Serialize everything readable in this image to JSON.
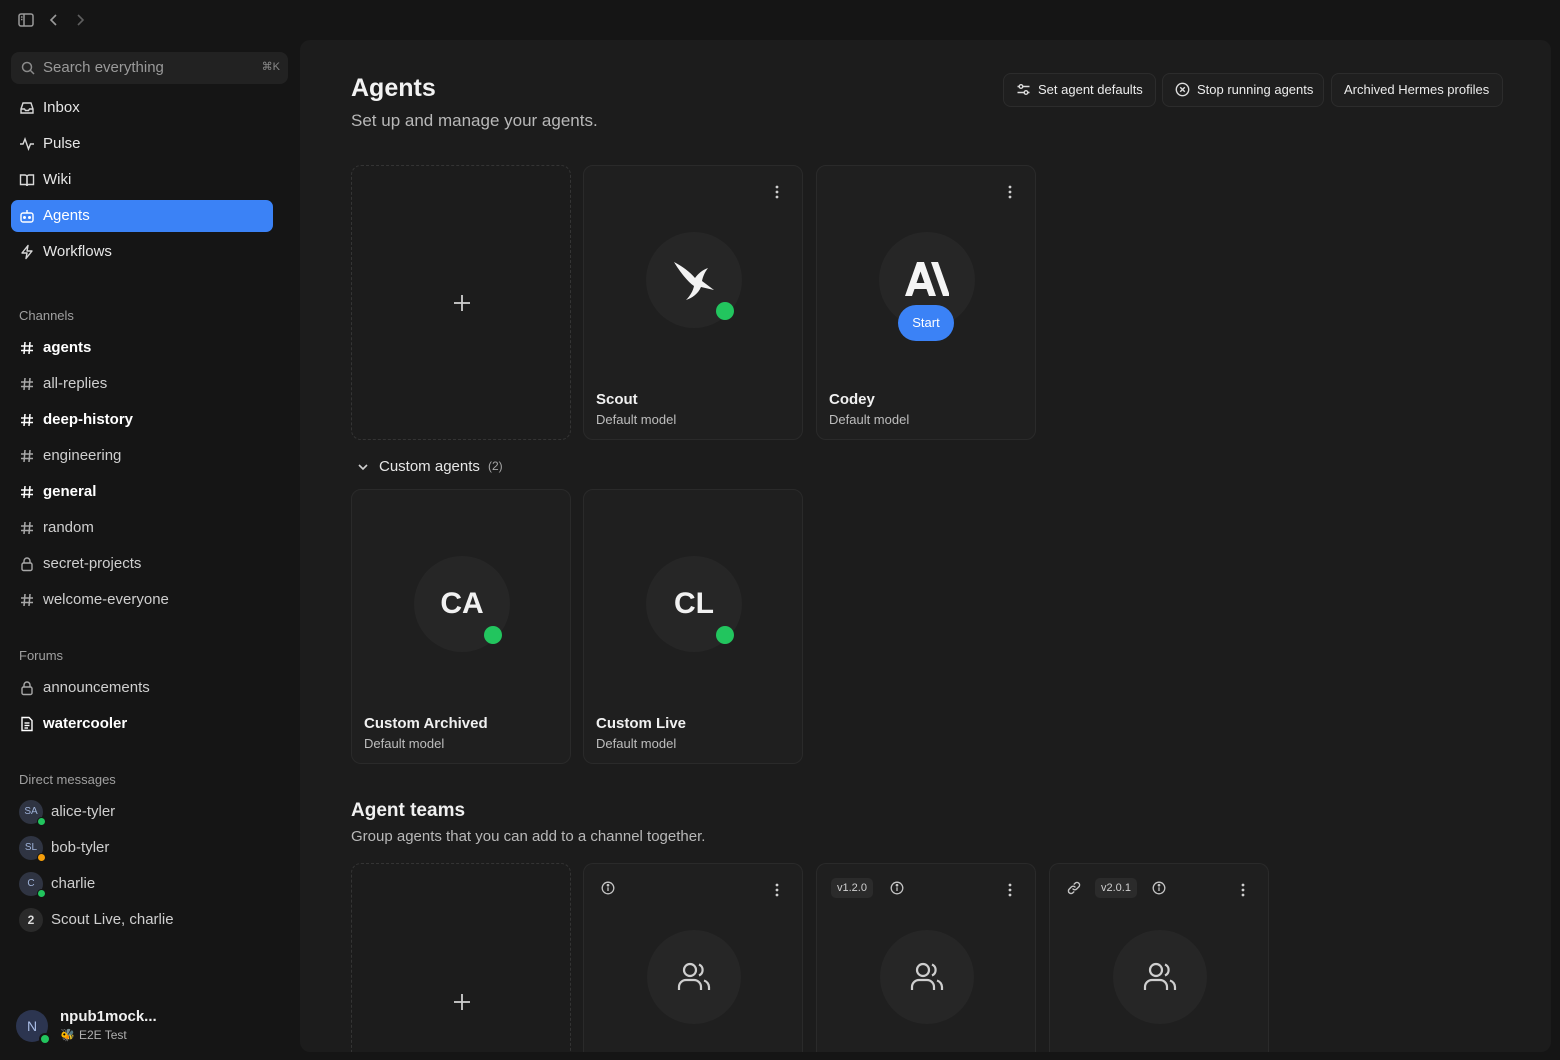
{
  "sidebar": {
    "search": {
      "placeholder": "Search everything",
      "shortcut": "⌘K"
    },
    "nav": [
      {
        "label": "Inbox",
        "icon": "inbox-icon"
      },
      {
        "label": "Pulse",
        "icon": "pulse-icon"
      },
      {
        "label": "Wiki",
        "icon": "book-icon"
      },
      {
        "label": "Agents",
        "icon": "bot-icon",
        "active": true
      },
      {
        "label": "Workflows",
        "icon": "lightning-icon"
      }
    ],
    "channels_title": "Channels",
    "channels": [
      {
        "name": "agents",
        "icon": "hash-icon",
        "unread": true
      },
      {
        "name": "all-replies",
        "icon": "hash-icon",
        "unread": false
      },
      {
        "name": "deep-history",
        "icon": "hash-icon",
        "unread": true
      },
      {
        "name": "engineering",
        "icon": "hash-icon",
        "unread": false
      },
      {
        "name": "general",
        "icon": "hash-icon",
        "unread": true
      },
      {
        "name": "random",
        "icon": "hash-icon",
        "unread": false
      },
      {
        "name": "secret-projects",
        "icon": "lock-icon",
        "unread": false
      },
      {
        "name": "welcome-everyone",
        "icon": "hash-icon",
        "unread": false
      }
    ],
    "forums_title": "Forums",
    "forums": [
      {
        "name": "announcements",
        "icon": "lock-icon",
        "unread": false
      },
      {
        "name": "watercooler",
        "icon": "document-icon",
        "unread": true
      }
    ],
    "dm_title": "Direct messages",
    "dms": [
      {
        "name": "alice-tyler",
        "avatar": "SA",
        "status": "online"
      },
      {
        "name": "bob-tyler",
        "avatar": "SL",
        "status": "away"
      },
      {
        "name": "charlie",
        "avatar": "C",
        "status": "online"
      },
      {
        "name": "Scout Live, charlie",
        "avatar": "2",
        "status": "none"
      }
    ],
    "user": {
      "initial": "N",
      "name": "npub1mock...",
      "subtitle": "E2E Test",
      "subtitle_icon": "bee-emoji"
    }
  },
  "main": {
    "title": "Agents",
    "subtitle": "Set up and manage your agents.",
    "header_buttons": [
      {
        "label": "Set agent defaults",
        "icon": "sliders-icon"
      },
      {
        "label": "Stop running agents",
        "icon": "stop-circle-icon"
      },
      {
        "label": "Archived Hermes profiles"
      }
    ],
    "agents": [
      {
        "name": "Scout",
        "model": "Default model",
        "avatar": "bird-icon",
        "status": "online"
      },
      {
        "name": "Codey",
        "model": "Default model",
        "avatar": "anthropic-logo",
        "action": "Start"
      }
    ],
    "custom_group": {
      "label": "Custom agents",
      "count": "(2)"
    },
    "custom_agents": [
      {
        "name": "Custom Archived",
        "model": "Default model",
        "initials": "CA",
        "status": "online"
      },
      {
        "name": "Custom Live",
        "model": "Default model",
        "initials": "CL",
        "status": "online"
      }
    ],
    "teams_title": "Agent teams",
    "teams_subtitle": "Group agents that you can add to a channel together.",
    "teams": [
      {
        "version": "",
        "linked": false
      },
      {
        "version": "v1.2.0",
        "linked": false
      },
      {
        "version": "v2.0.1",
        "linked": true
      }
    ]
  },
  "colors": {
    "accent": "#3b82f6",
    "online": "#22c55e",
    "away": "#f59e0b"
  }
}
